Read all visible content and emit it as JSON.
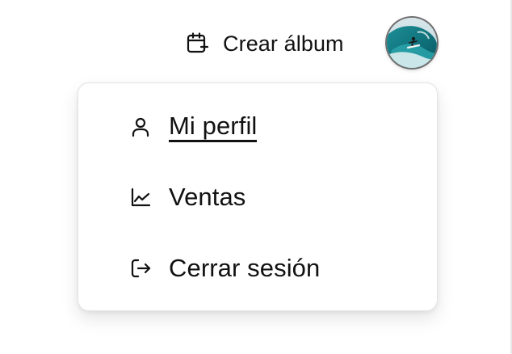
{
  "header": {
    "create_album_label": "Crear álbum",
    "create_album_icon": "calendar-plus-icon",
    "avatar_icon": "user-avatar-surf-photo"
  },
  "menu": {
    "items": [
      {
        "label": "Mi perfil",
        "icon": "user-icon",
        "active": true
      },
      {
        "label": "Ventas",
        "icon": "chart-line-icon",
        "active": false
      },
      {
        "label": "Cerrar sesión",
        "icon": "logout-icon",
        "active": false
      }
    ]
  },
  "colors": {
    "text": "#111111",
    "menu_border": "#e3e3e3",
    "background": "#ffffff"
  }
}
